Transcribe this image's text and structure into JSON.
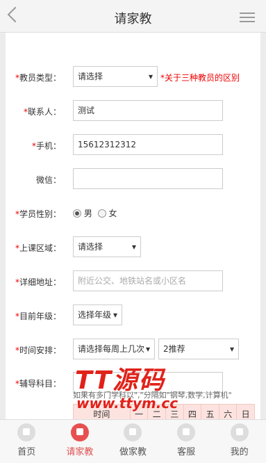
{
  "header": {
    "title": "请家教"
  },
  "form": {
    "teacher_type": {
      "label": "教员类型：",
      "value": "请选择",
      "note": "*关于三种教员的区别"
    },
    "contact": {
      "label": "联系人：",
      "value": "测试"
    },
    "phone": {
      "label": "手机：",
      "value": "15612312312"
    },
    "wechat": {
      "label": "微信：",
      "value": ""
    },
    "gender": {
      "label": "学员性别：",
      "options": [
        "男",
        "女"
      ],
      "selected": "男"
    },
    "area": {
      "label": "上课区域：",
      "value": "请选择"
    },
    "address": {
      "label": "详细地址：",
      "placeholder": "附近公交、地铁站名或小区名"
    },
    "grade": {
      "label": "目前年级：",
      "value": "选择年级"
    },
    "schedule": {
      "label": "时间安排：",
      "value1": "请选择每周上几次",
      "value2": "2推荐"
    },
    "subject": {
      "label": "辅导科目：",
      "value": "",
      "hint": "如果有多门学科以\",\"分隔如\"钢琴,数学,计算机\""
    },
    "week_table": {
      "headers": [
        "时间",
        "一",
        "二",
        "三",
        "四",
        "五",
        "六",
        "日"
      ]
    }
  },
  "watermark": {
    "line1": "TT源码",
    "line2": "www.ttym.cc"
  },
  "tabbar": [
    {
      "label": "首页",
      "icon": "home-icon",
      "active": false
    },
    {
      "label": "请家教",
      "icon": "user-icon",
      "active": true
    },
    {
      "label": "做家教",
      "icon": "teacher-icon",
      "active": false
    },
    {
      "label": "客服",
      "icon": "service-icon",
      "active": false
    },
    {
      "label": "我的",
      "icon": "profile-icon",
      "active": false
    }
  ],
  "colors": {
    "accent": "#e05050",
    "required": "#e00000"
  }
}
